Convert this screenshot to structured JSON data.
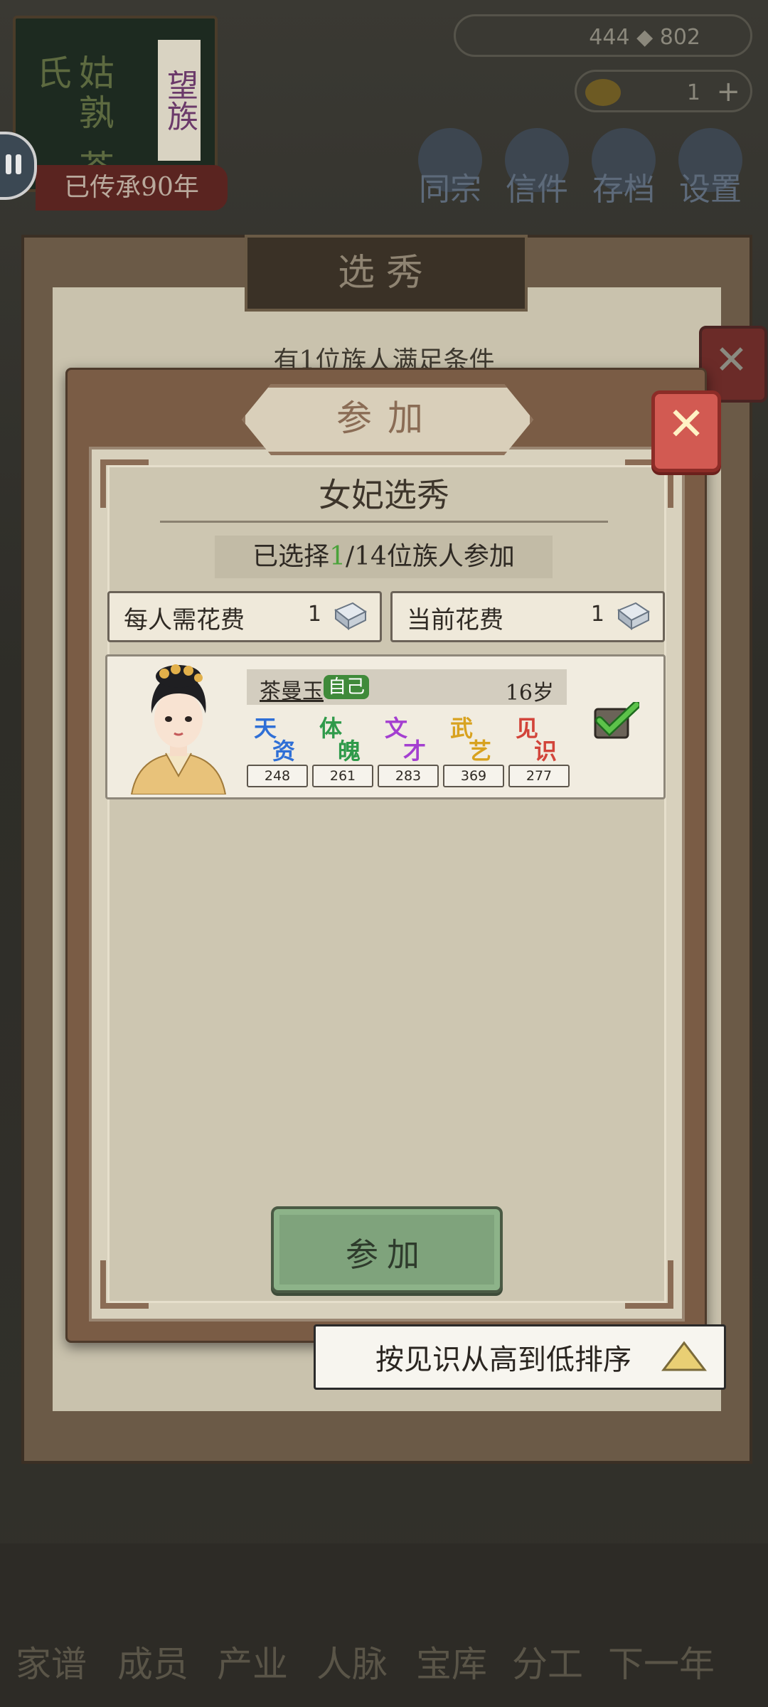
{
  "top": {
    "clan_name": "姑孰",
    "clan_surname": "茶氏",
    "clan_tag": "望族",
    "inherit_label": "已传承90年",
    "resource1_value": "444",
    "resource1_value2": "802",
    "resource2_value": "1",
    "menu": [
      {
        "label": "同宗",
        "icon": "clan-icon"
      },
      {
        "label": "信件",
        "icon": "letter-icon"
      },
      {
        "label": "存档",
        "icon": "save-icon"
      },
      {
        "label": "设置",
        "icon": "settings-icon"
      }
    ]
  },
  "background_window": {
    "title": "选秀",
    "hint": "有1位族人满足条件"
  },
  "dialog": {
    "title": "参加",
    "subtitle": "女妃选秀",
    "selected_prefix": "已选择",
    "selected_count": "1",
    "selected_suffix": "/14位族人参加",
    "cost_per_person_label": "每人需花费",
    "cost_per_person_value": "1",
    "current_cost_label": "当前花费",
    "current_cost_value": "1",
    "member": {
      "name": "茶曼玉",
      "self_badge": "自己",
      "age": "16岁",
      "checked": true,
      "stats": [
        {
          "label_a": "天",
          "label_b": "资",
          "value": "248",
          "color": "#2f6fd6"
        },
        {
          "label_a": "体",
          "label_b": "魄",
          "value": "261",
          "color": "#2f9a4a"
        },
        {
          "label_a": "文",
          "label_b": "才",
          "value": "283",
          "color": "#a43fd0"
        },
        {
          "label_a": "武",
          "label_b": "艺",
          "value": "369",
          "color": "#d8a21f"
        },
        {
          "label_a": "见",
          "label_b": "识",
          "value": "277",
          "color": "#d2443a"
        }
      ]
    },
    "join_button": "参加"
  },
  "sort_tip": "按见识从高到低排序",
  "bottom_nav": [
    "家谱",
    "成员",
    "产业",
    "人脉",
    "宝库",
    "分工",
    "下一年"
  ],
  "colors": {
    "accent_green": "#4aa23a",
    "close_red": "#d25a52",
    "dialog_frame": "#7a5c45"
  }
}
